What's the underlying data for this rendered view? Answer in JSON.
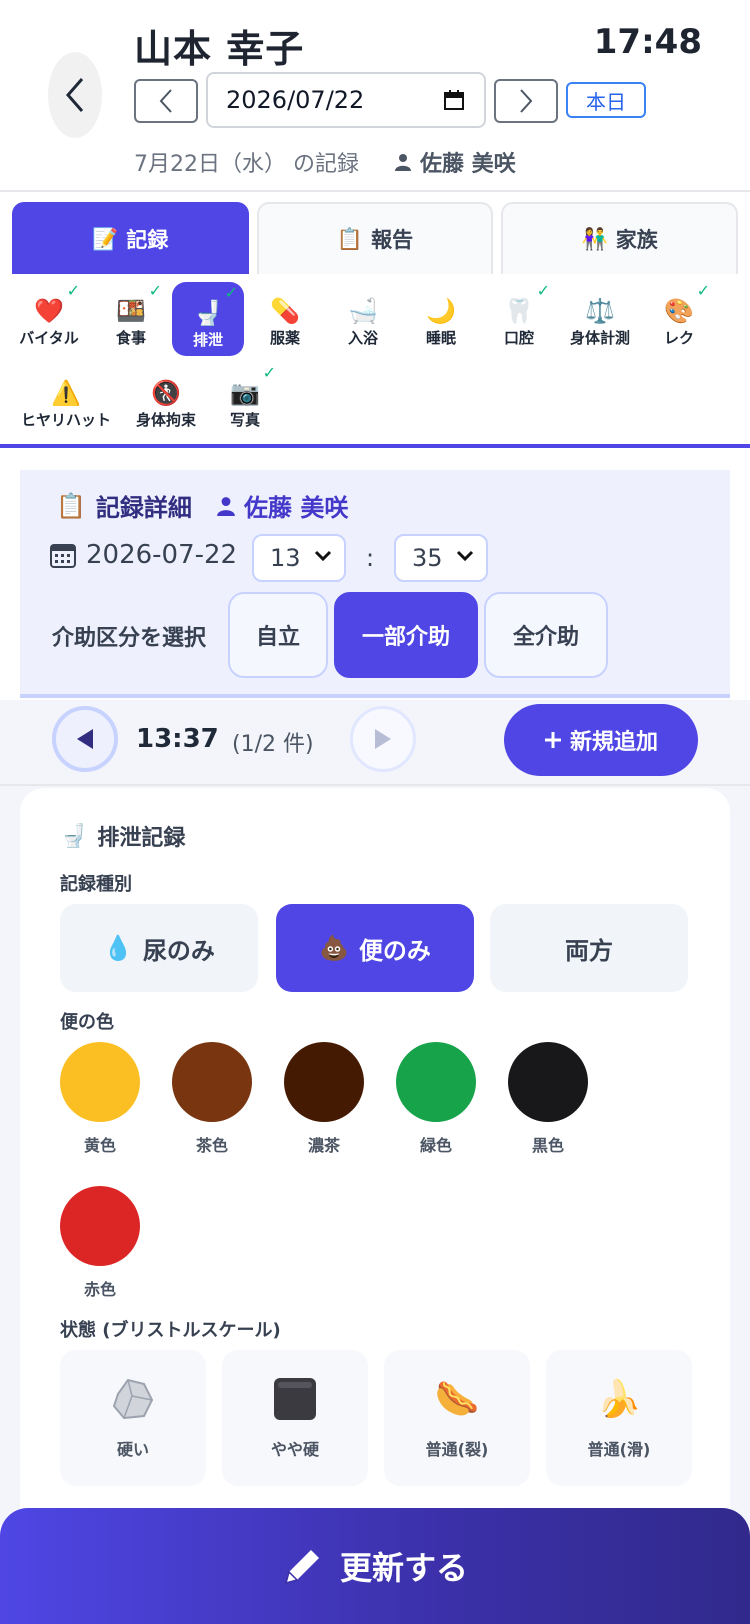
{
  "header": {
    "patient_name": "山本 幸子",
    "clock": "17:48",
    "date_value": "2026/07/22",
    "today_label": "本日",
    "record_date_label": "7月22日（水） の記録",
    "staff_name": "佐藤 美咲"
  },
  "main_tabs": [
    {
      "label": "記録",
      "icon": "📝",
      "active": true
    },
    {
      "label": "報告",
      "icon": "📋",
      "active": false
    },
    {
      "label": "家族",
      "icon": "👫",
      "active": false
    }
  ],
  "categories": [
    {
      "label": "バイタル",
      "icon": "❤️",
      "checked": true
    },
    {
      "label": "食事",
      "icon": "🍱",
      "checked": true
    },
    {
      "label": "排泄",
      "icon": "🚽",
      "checked": true,
      "active": true
    },
    {
      "label": "服薬",
      "icon": "💊",
      "checked": false
    },
    {
      "label": "入浴",
      "icon": "🛁",
      "checked": false
    },
    {
      "label": "睡眠",
      "icon": "🌙",
      "checked": false
    },
    {
      "label": "口腔",
      "icon": "🦷",
      "checked": true
    },
    {
      "label": "身体計測",
      "icon": "⚖️",
      "checked": false
    },
    {
      "label": "レク",
      "icon": "🎨",
      "checked": true
    },
    {
      "label": "ヒヤリハット",
      "icon": "⚠️",
      "checked": false
    },
    {
      "label": "身体拘束",
      "icon": "🚷",
      "checked": false
    },
    {
      "label": "写真",
      "icon": "📷",
      "checked": true
    }
  ],
  "detail": {
    "title": "記録詳細",
    "staff_name": "佐藤 美咲",
    "date": "2026-07-22",
    "hour": "13",
    "colon": ":",
    "minute": "35",
    "assist_label": "介助区分を選択",
    "assist_options": [
      "自立",
      "一部介助",
      "全介助"
    ],
    "assist_selected": "一部介助"
  },
  "record_nav": {
    "time": "13:37",
    "count": "(1/2 件)",
    "add_label": "新規追加"
  },
  "elimination": {
    "title": "排泄記録",
    "type_label": "記録種別",
    "types": [
      {
        "label": "尿のみ",
        "icon": "💧"
      },
      {
        "label": "便のみ",
        "icon": "💩"
      },
      {
        "label": "両方",
        "icon": ""
      }
    ],
    "type_selected": "便のみ",
    "color_label": "便の色",
    "colors": [
      {
        "label": "黄色",
        "hex": "#fbbf24"
      },
      {
        "label": "茶色",
        "hex": "#78350f"
      },
      {
        "label": "濃茶",
        "hex": "#451a03"
      },
      {
        "label": "緑色",
        "hex": "#16a34a"
      },
      {
        "label": "黒色",
        "hex": "#18181b"
      },
      {
        "label": "赤色",
        "hex": "#dc2626"
      }
    ],
    "state_label": "状態 (ブリストルスケール)",
    "states": [
      {
        "label": "硬い",
        "icon": "rock-icon"
      },
      {
        "label": "やや硬",
        "icon": "dark-block-icon"
      },
      {
        "label": "普通(裂)",
        "icon": "🌭"
      },
      {
        "label": "普通(滑)",
        "icon": "🍌"
      }
    ]
  },
  "update_label": "更新する",
  "colors": {
    "accent": "#4f46e5",
    "check": "#10b981"
  }
}
